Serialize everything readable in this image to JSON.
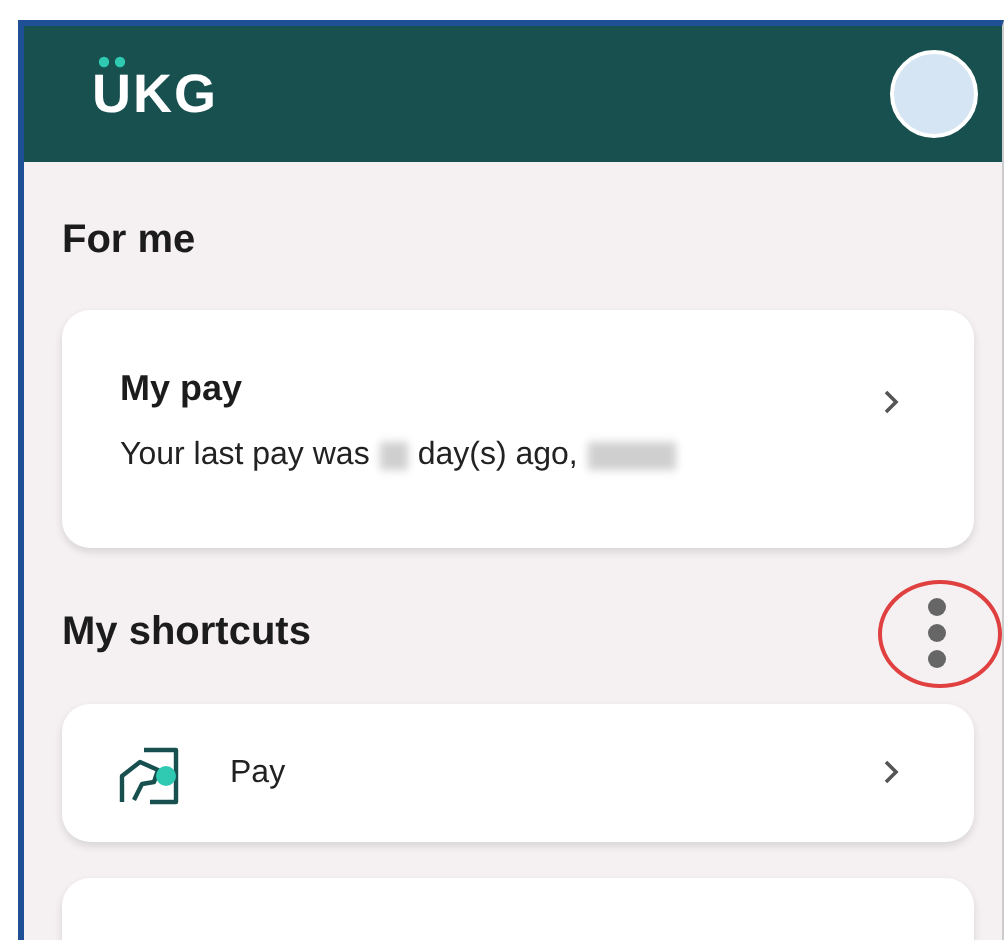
{
  "header": {
    "logo": "UKG"
  },
  "sections": [
    {
      "title": "For me",
      "cards": [
        {
          "kind": "summary",
          "title": "My pay",
          "summary": [
            {
              "kind": "text",
              "text": "Your last pay was"
            },
            {
              "kind": "redacted"
            },
            {
              "kind": "text",
              "text": "day(s) ago,"
            },
            {
              "kind": "redacted"
            }
          ]
        }
      ]
    },
    {
      "title": "My shortcuts",
      "menu": true,
      "menu_highlighted": true,
      "cards": [
        {
          "kind": "shortcut",
          "label": "Pay"
        },
        {
          "kind": "empty"
        }
      ]
    }
  ]
}
